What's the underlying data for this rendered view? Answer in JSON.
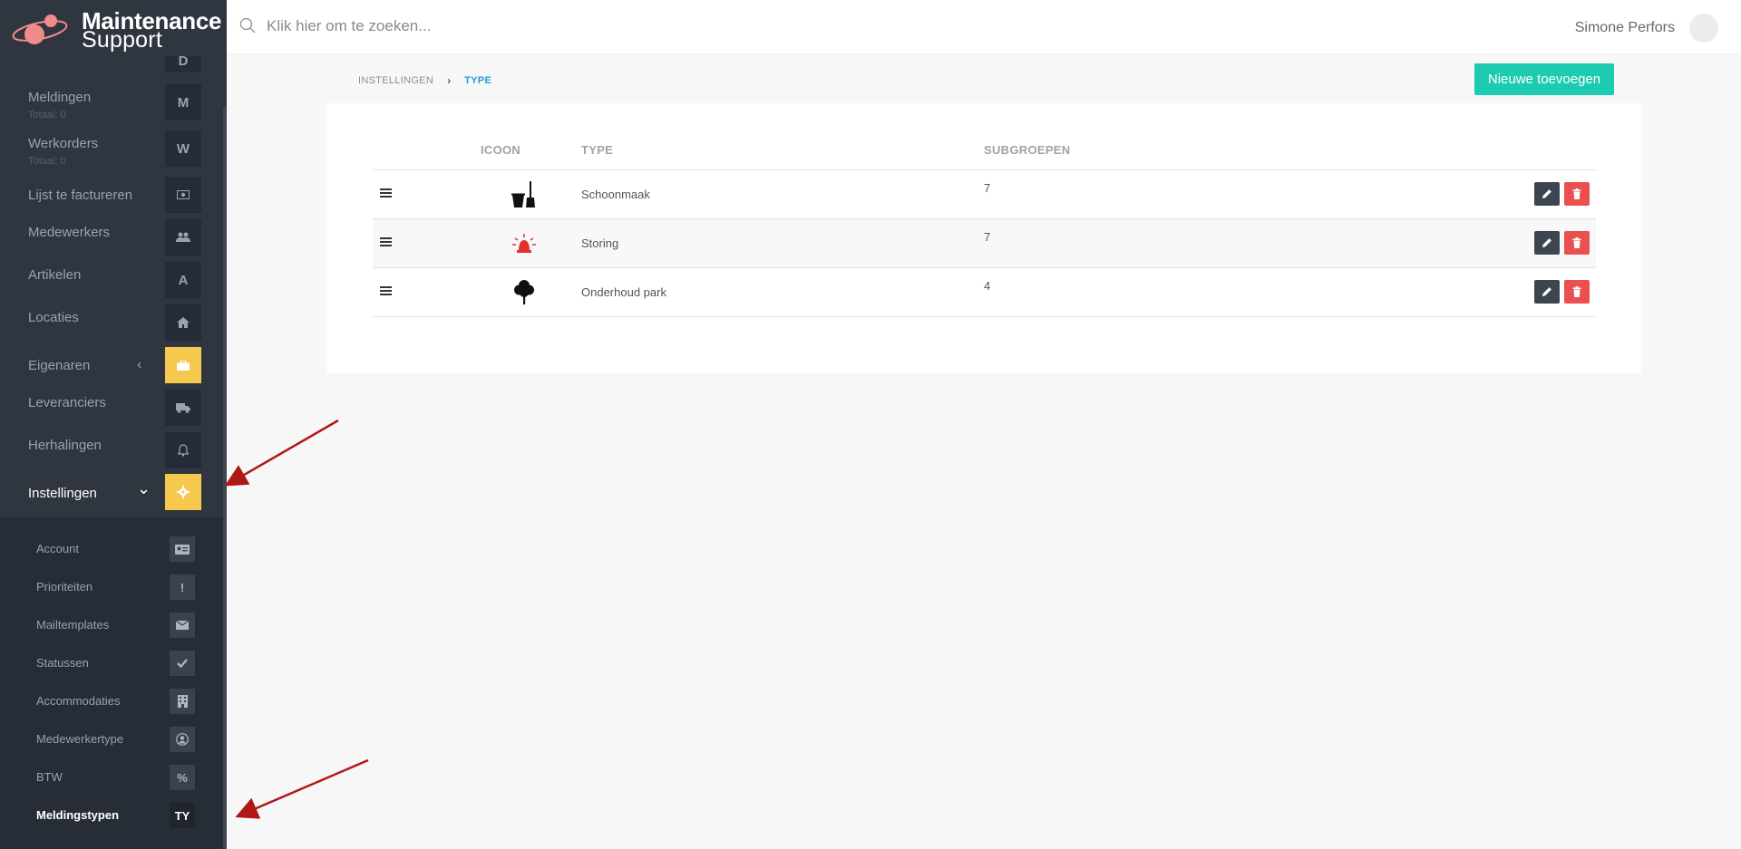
{
  "app": {
    "brand_line1": "Maintenance",
    "brand_line2": "Support"
  },
  "search": {
    "placeholder": "Klik hier om te zoeken..."
  },
  "user": {
    "name": "Simone Perfors"
  },
  "sidebar": {
    "items": [
      {
        "label": "Meldingen",
        "sublabel": "Totaal: 0",
        "icon_text": "M",
        "icon": "letter-m"
      },
      {
        "label": "Werkorders",
        "sublabel": "Totaal: 0",
        "icon_text": "W",
        "icon": "letter-w"
      },
      {
        "label": "Lijst te factureren",
        "icon": "money-icon"
      },
      {
        "label": "Medewerkers",
        "icon": "users-icon"
      },
      {
        "label": "Artikelen",
        "icon_text": "A",
        "icon": "letter-a"
      },
      {
        "label": "Locaties",
        "icon": "home-icon"
      },
      {
        "label": "Eigenaren",
        "icon": "briefcase-icon",
        "chevron": "‹"
      },
      {
        "label": "Leveranciers",
        "icon": "truck-icon"
      },
      {
        "label": "Herhalingen",
        "icon": "bell-icon"
      },
      {
        "label": "Instellingen",
        "icon": "gear-icon",
        "chevron": "⌄"
      }
    ],
    "top_partial_icon_text": "D",
    "submenu": [
      {
        "label": "Account",
        "icon": "id-card-icon"
      },
      {
        "label": "Prioriteiten",
        "icon_text": "!",
        "icon": "exclamation-icon"
      },
      {
        "label": "Mailtemplates",
        "icon": "envelope-icon"
      },
      {
        "label": "Statussen",
        "icon": "check-icon"
      },
      {
        "label": "Accommodaties",
        "icon": "building-icon"
      },
      {
        "label": "Medewerkertype",
        "icon": "user-circle-icon"
      },
      {
        "label": "BTW",
        "icon_text": "%",
        "icon": "percent-icon"
      },
      {
        "label": "Meldingstypen",
        "icon_text": "TY",
        "icon": "ty-icon"
      }
    ],
    "colors": {
      "background": "#2f3640",
      "accent": "#f6c94e"
    }
  },
  "breadcrumb": {
    "parent": "INSTELLINGEN",
    "current": "TYPE"
  },
  "toolbar": {
    "add_label": "Nieuwe toevoegen",
    "add_color": "#1dcbb2"
  },
  "table": {
    "headers": [
      "",
      "ICOON",
      "TYPE",
      "SUBGROEPEN",
      ""
    ],
    "rows": [
      {
        "icon": "broom-bucket-icon",
        "type": "Schoonmaak",
        "subgroups": "7"
      },
      {
        "icon": "alarm-light-icon",
        "type": "Storing",
        "subgroups": "7"
      },
      {
        "icon": "tree-icon",
        "type": "Onderhoud park",
        "subgroups": "4"
      }
    ]
  }
}
